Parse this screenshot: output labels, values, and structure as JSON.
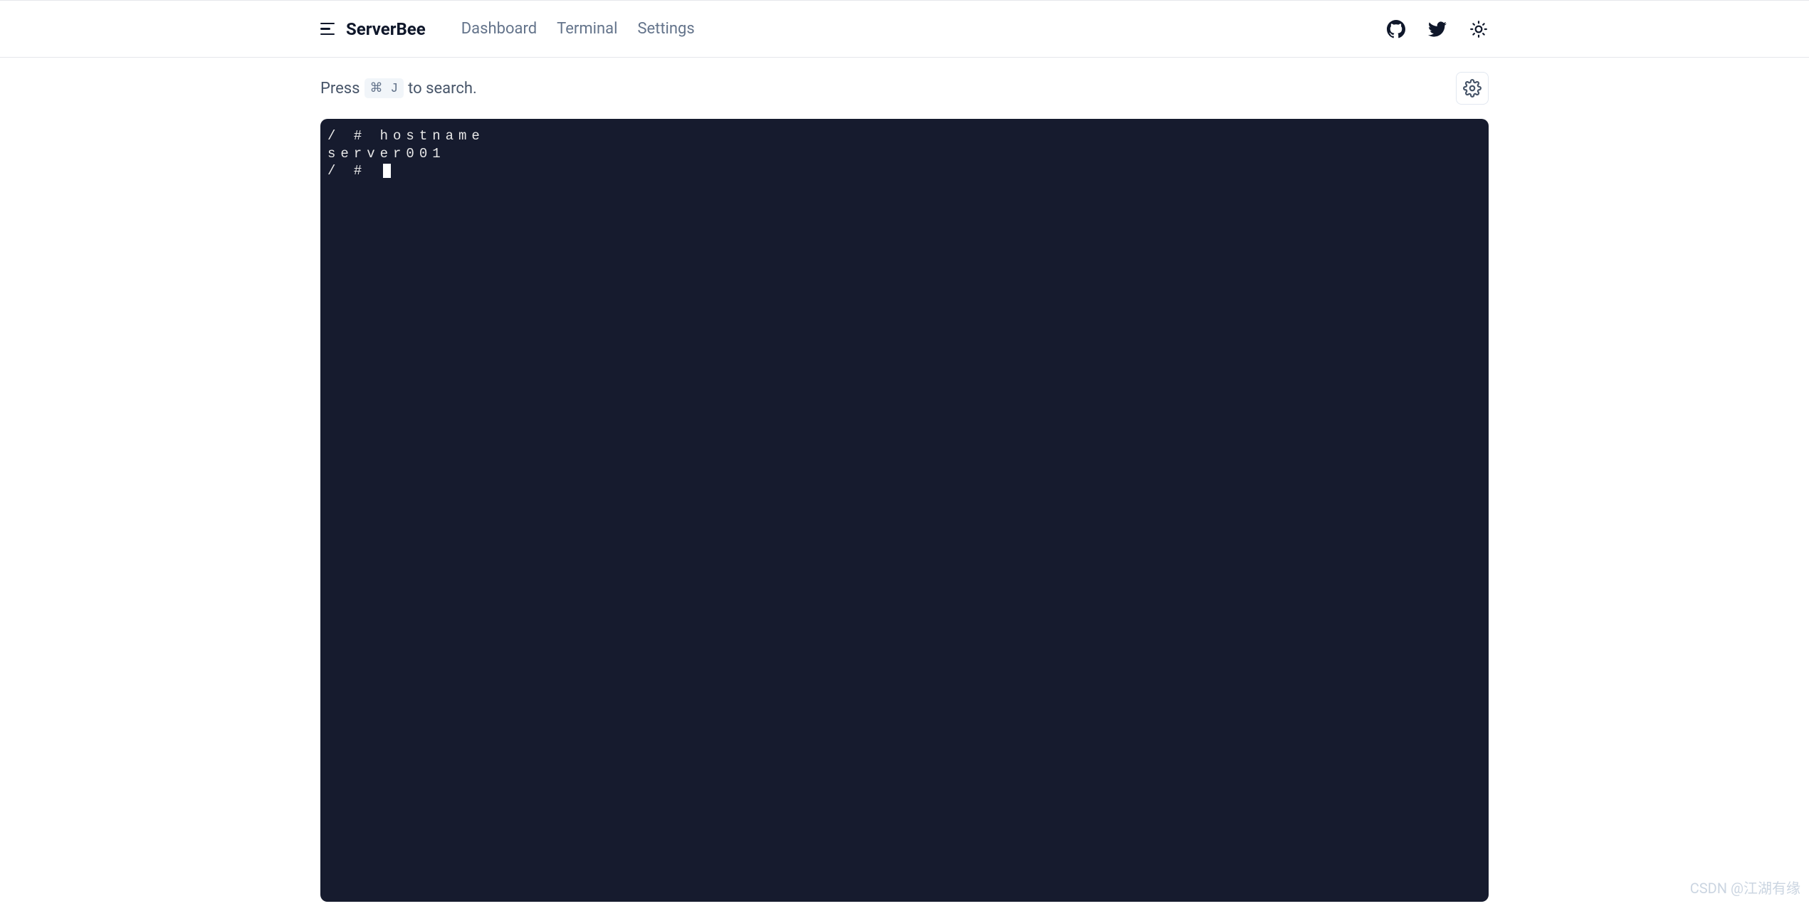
{
  "brand": {
    "name": "ServerBee"
  },
  "nav": {
    "dashboard": "Dashboard",
    "terminal": "Terminal",
    "settings": "Settings"
  },
  "search": {
    "press": "Press",
    "shortcut": "⌘ J",
    "suffix": "to search."
  },
  "terminal": {
    "lines": [
      "/ # hostname",
      "server001",
      "/ # "
    ]
  },
  "watermark": "CSDN @江湖有缘"
}
